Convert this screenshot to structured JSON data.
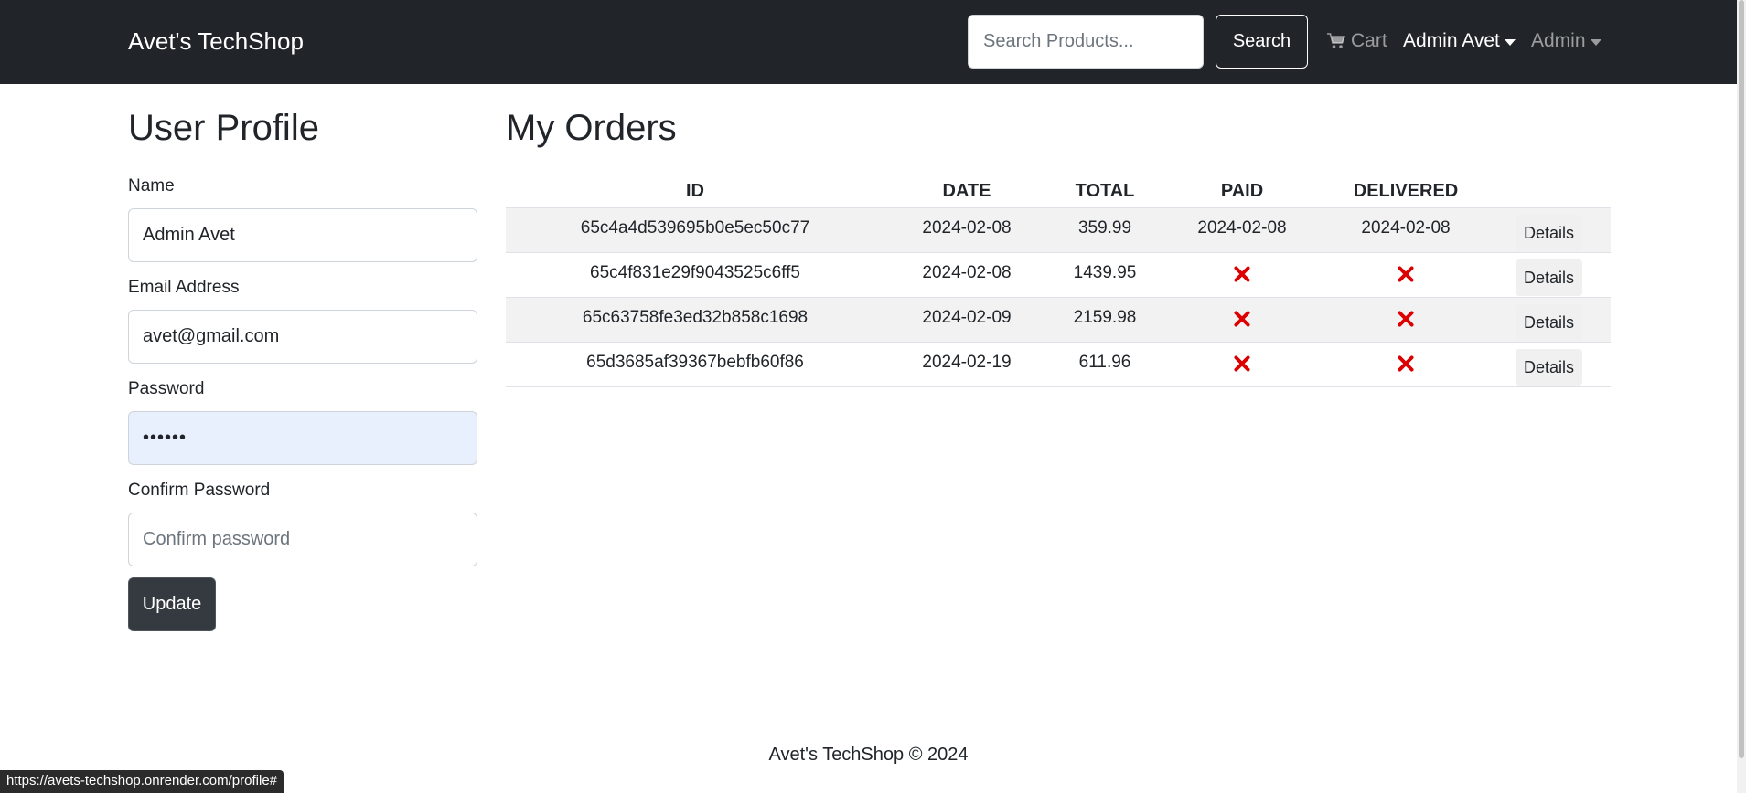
{
  "navbar": {
    "brand": "Avet's TechShop",
    "search_placeholder": "Search Products...",
    "search_button": "Search",
    "cart_label": "Cart",
    "user_menu": "Admin Avet",
    "admin_menu": "Admin"
  },
  "profile": {
    "title": "User Profile",
    "name_label": "Name",
    "name_value": "Admin Avet",
    "email_label": "Email Address",
    "email_value": "avet@gmail.com",
    "password_label": "Password",
    "password_value": "••••••",
    "confirm_label": "Confirm Password",
    "confirm_placeholder": "Confirm password",
    "update_button": "Update"
  },
  "orders": {
    "title": "My Orders",
    "columns": [
      "ID",
      "DATE",
      "TOTAL",
      "PAID",
      "DELIVERED"
    ],
    "details_label": "Details",
    "rows": [
      {
        "id": "65c4a4d539695b0e5ec50c77",
        "date": "2024-02-08",
        "total": "359.99",
        "paid": "2024-02-08",
        "delivered": "2024-02-08"
      },
      {
        "id": "65c4f831e29f9043525c6ff5",
        "date": "2024-02-08",
        "total": "1439.95",
        "paid": "",
        "delivered": ""
      },
      {
        "id": "65c63758fe3ed32b858c1698",
        "date": "2024-02-09",
        "total": "2159.98",
        "paid": "",
        "delivered": ""
      },
      {
        "id": "65d3685af39367bebfb60f86",
        "date": "2024-02-19",
        "total": "611.96",
        "paid": "",
        "delivered": ""
      }
    ]
  },
  "footer": {
    "text": "Avet's TechShop © 2024"
  },
  "status_bar": {
    "url": "https://avets-techshop.onrender.com/profile#"
  },
  "colors": {
    "navbar": "#212529",
    "cancel_icon": "#dc0000",
    "button_dark": "#343a40"
  }
}
